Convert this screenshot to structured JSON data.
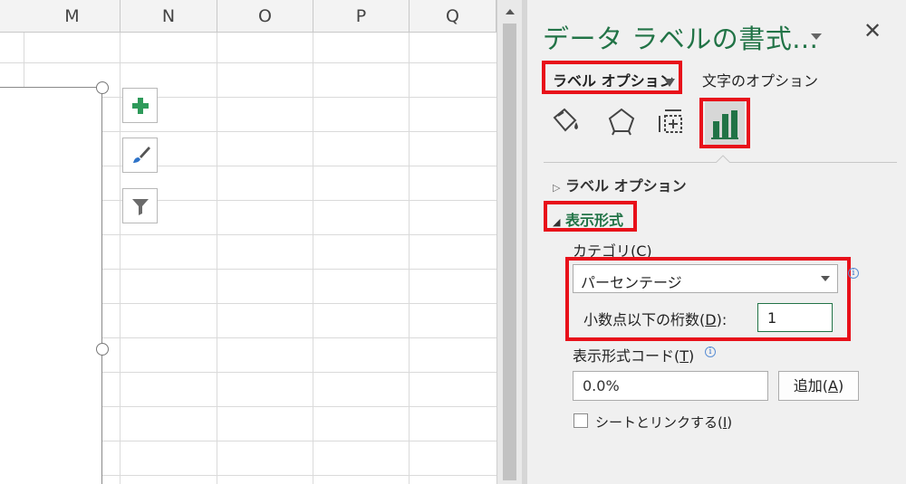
{
  "sheet": {
    "columns": [
      "M",
      "N",
      "O",
      "P",
      "Q"
    ]
  },
  "chart_tools": {
    "icons": [
      "plus-icon",
      "brush-icon",
      "filter-icon"
    ]
  },
  "pane": {
    "title": "データ ラベルの書式...",
    "tabs": {
      "label_options": "ラベル オプション",
      "text_options": "文字のオプション"
    },
    "icons": [
      "fill-line-icon",
      "effects-pentagon-icon",
      "size-properties-icon",
      "label-options-chart-icon"
    ],
    "sections": {
      "label_options": "ラベル オプション",
      "display_format": "表示形式"
    },
    "category": {
      "label": "カテゴリ(",
      "key": "C",
      "label_end": ")",
      "selected": "パーセンテージ"
    },
    "decimal_places": {
      "label": "小数点以下の桁数(",
      "key": "D",
      "label_end": "):",
      "value": "1"
    },
    "format_code": {
      "label": "表示形式コード(",
      "key": "T",
      "label_end": ")",
      "value": "0.0%"
    },
    "add_button": {
      "label": "追加(",
      "key": "A",
      "label_end": ")"
    },
    "link_to_source": {
      "label": "シートとリンクする(",
      "key": "I",
      "label_end": ")",
      "checked": false
    }
  },
  "colors": {
    "accent_green": "#217346",
    "highlight_red": "#e8101a"
  }
}
